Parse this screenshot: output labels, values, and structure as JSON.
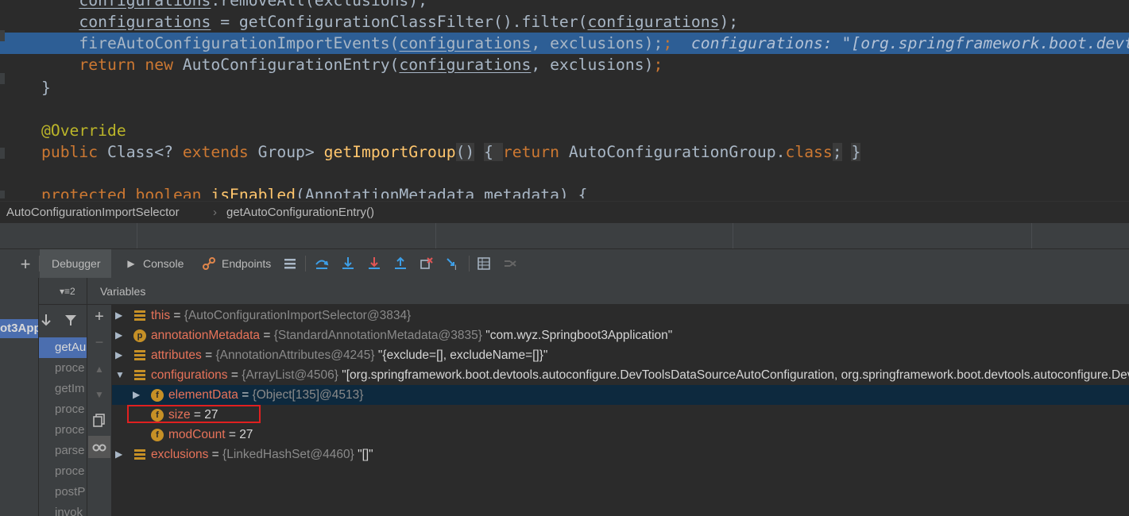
{
  "editor": {
    "lines": [
      {
        "id": "l0",
        "parts": [
          [
            "def",
            "    "
          ],
          [
            "u",
            "configurations"
          ],
          [
            "def",
            ".removeAll(exclusions);"
          ]
        ]
      },
      {
        "id": "l1",
        "parts": [
          [
            "def",
            "    "
          ],
          [
            "u",
            "configurations"
          ],
          [
            "def",
            " = getConfigurationClassFilter().filter("
          ],
          [
            "u",
            "configurations"
          ],
          [
            "def",
            ");"
          ]
        ]
      },
      {
        "id": "l2",
        "parts": [
          [
            "def",
            "    fireAutoConfigurationImportEvents("
          ],
          [
            "u",
            "configurations"
          ],
          [
            "def",
            ", exclusions);"
          ],
          [
            "kw",
            ";"
          ],
          [
            "inl",
            "  configurations: \"[org.springframework.boot.devtools.autoconfigure.DevToolsDataSourceAutoConfiguration\""
          ]
        ]
      },
      {
        "id": "l3",
        "parts": [
          [
            "kw",
            "    return new "
          ],
          [
            "def",
            "AutoConfigurationEntry("
          ],
          [
            "u",
            "configurations"
          ],
          [
            "def",
            ", exclusions)"
          ],
          [
            "kw",
            ";"
          ]
        ]
      },
      {
        "id": "l4",
        "parts": [
          [
            "def",
            "}"
          ]
        ]
      },
      {
        "id": "l5",
        "parts": [
          [
            "def",
            ""
          ]
        ]
      },
      {
        "id": "l6",
        "parts": [
          [
            "an",
            "@Override"
          ]
        ]
      },
      {
        "id": "l7",
        "parts": [
          [
            "kw",
            "public "
          ],
          [
            "def",
            "Class<? "
          ],
          [
            "kw",
            "extends "
          ],
          [
            "def",
            "Group> "
          ],
          [
            "fn",
            "getImportGroup"
          ],
          [
            "fold",
            "()"
          ],
          [
            "def",
            " "
          ],
          [
            "fold",
            "{ "
          ],
          [
            "kw",
            "return "
          ],
          [
            "def",
            "AutoConfigurationGroup."
          ],
          [
            "kw",
            "class"
          ],
          [
            "fold",
            ";"
          ],
          [
            "def",
            " "
          ],
          [
            "fold",
            "}"
          ]
        ]
      },
      {
        "id": "l8",
        "parts": [
          [
            "def",
            ""
          ]
        ]
      },
      {
        "id": "l9",
        "parts": [
          [
            "kw",
            "protected boolean "
          ],
          [
            "fn",
            "isEnabled"
          ],
          [
            "def",
            "(AnnotationMetadata metadata) {"
          ]
        ]
      }
    ]
  },
  "breadcrumb": {
    "class": "AutoConfigurationImportSelector",
    "sep": "›",
    "method": "getAutoConfigurationEntry()"
  },
  "toolbar": {
    "add": "+",
    "debugger": "Debugger",
    "console": "Console",
    "endpoints": "Endpoints"
  },
  "left": {
    "app_label": "ot3App",
    "frames_sort": "▾≡2",
    "frames": [
      "getAu",
      "proce",
      "getIm",
      "proce",
      "proce",
      "parse",
      "proce",
      "postP",
      "invok"
    ]
  },
  "variables": {
    "header": "Variables",
    "rows": [
      {
        "id": "this",
        "indent": 0,
        "arrow": "▶",
        "icon": "list",
        "name": "this",
        "type": "{AutoConfigurationImportSelector@3834}",
        "value": ""
      },
      {
        "id": "annotationMetadata",
        "indent": 0,
        "arrow": "▶",
        "icon": "p",
        "name": "annotationMetadata",
        "type": "{StandardAnnotationMetadata@3835}",
        "value": "\"com.wyz.Springboot3Application\""
      },
      {
        "id": "attributes",
        "indent": 0,
        "arrow": "▶",
        "icon": "list",
        "name": "attributes",
        "type": "{AnnotationAttributes@4245}",
        "value": "\"{exclude=[], excludeName=[]}\""
      },
      {
        "id": "configurations",
        "indent": 0,
        "arrow": "▼",
        "icon": "list",
        "name": "configurations",
        "type": "{ArrayList@4506}",
        "value": "\"[org.springframework.boot.devtools.autoconfigure.DevToolsDataSourceAutoConfiguration, org.springframework.boot.devtools.autoconfigure.DevToolsR"
      },
      {
        "id": "elementData",
        "indent": 1,
        "arrow": "▶",
        "icon": "f",
        "name": "elementData",
        "type": "{Object[135]@4513}",
        "value": "",
        "selected": true
      },
      {
        "id": "size",
        "indent": 1,
        "arrow": "",
        "icon": "f",
        "name": "size",
        "type": "",
        "value": "27"
      },
      {
        "id": "modCount",
        "indent": 1,
        "arrow": "",
        "icon": "f",
        "name": "modCount",
        "type": "",
        "value": "27"
      },
      {
        "id": "exclusions",
        "indent": 0,
        "arrow": "▶",
        "icon": "list",
        "name": "exclusions",
        "type": "{LinkedHashSet@4460}",
        "value": "\"[]\""
      }
    ]
  },
  "colors": {
    "highlight_line": "#2d5e95",
    "selected_row": "#0d293e",
    "selected_frame": "#4b6eaf",
    "annotation_box": "#e02020"
  }
}
